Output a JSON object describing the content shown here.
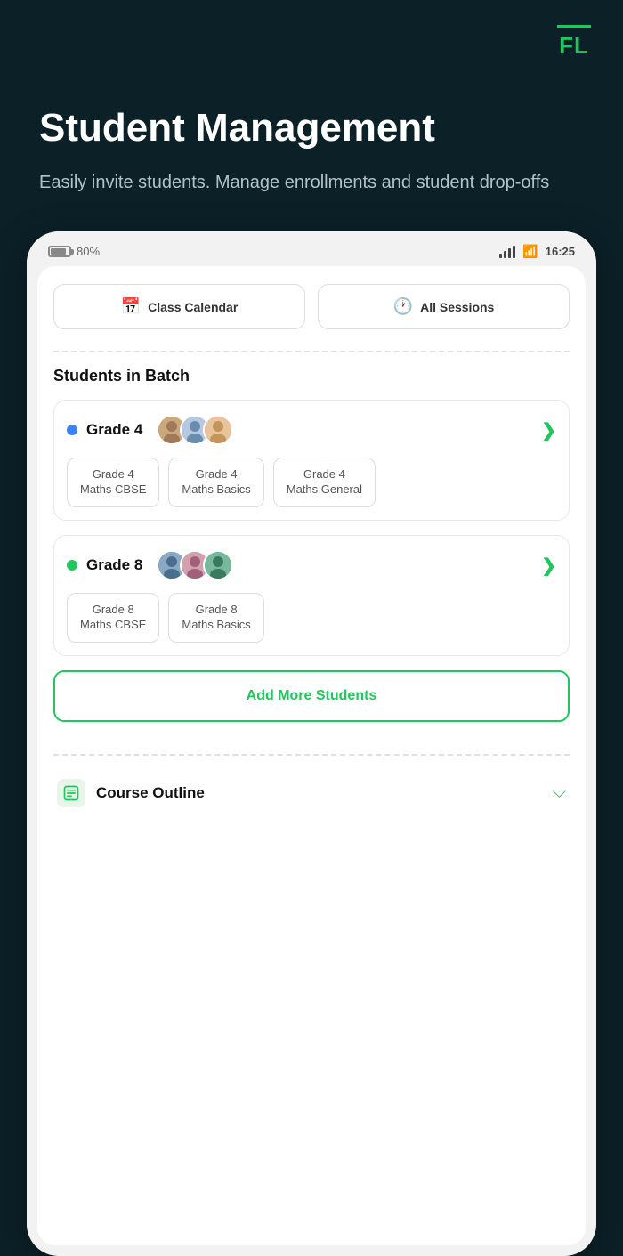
{
  "logo": {
    "text": "FL"
  },
  "header": {
    "title": "Student Management",
    "subtitle": "Easily invite students. Manage enrollments and student drop-offs"
  },
  "status_bar": {
    "battery": "80%",
    "time": "16:25"
  },
  "action_buttons": [
    {
      "id": "class-calendar",
      "icon": "📅",
      "label": "Class Calendar"
    },
    {
      "id": "all-sessions",
      "icon": "🕐",
      "label": "All Sessions"
    }
  ],
  "students_section": {
    "title": "Students in Batch",
    "grades": [
      {
        "id": "grade4",
        "name": "Grade 4",
        "dot_color": "#3b82f6",
        "subjects": [
          "Grade 4\nMaths CBSE",
          "Grade 4\nMaths Basics",
          "Grade 4\nMaths General"
        ],
        "avatars": [
          "A1",
          "A2",
          "A3"
        ]
      },
      {
        "id": "grade8",
        "name": "Grade 8",
        "dot_color": "#22c55e",
        "subjects": [
          "Grade 8\nMaths CBSE",
          "Grade 8\nMaths Basics"
        ],
        "avatars": [
          "B1",
          "B2",
          "B3"
        ]
      }
    ]
  },
  "add_students_button": {
    "label": "Add More Students"
  },
  "course_outline": {
    "label": "Course Outline"
  }
}
